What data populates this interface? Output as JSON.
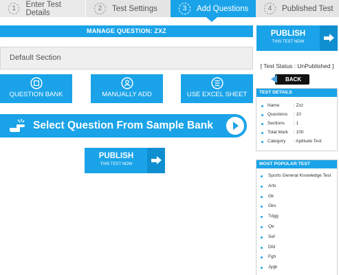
{
  "steps": [
    {
      "num": "1",
      "label": "Enter Test Details"
    },
    {
      "num": "2",
      "label": "Test Settings"
    },
    {
      "num": "3",
      "label": "Add Questions"
    },
    {
      "num": "4",
      "label": "Published Test"
    }
  ],
  "manage": {
    "title": "MANAGE QUESTION: ZXZ"
  },
  "section": {
    "name": "Default Section"
  },
  "actions": {
    "question_bank": "QUESTION BANK",
    "manually_add": "MANUALLY ADD",
    "excel": "USE EXCEL SHEET"
  },
  "sample_bank": {
    "label": "Select Question From Sample Bank"
  },
  "publish": {
    "title": "PUBLISH",
    "subtitle": "THIS TEST NOW"
  },
  "sidebar": {
    "status": "[ Test Status : UnPublished ]",
    "back": "BACK",
    "details_title": "TEST DETAILS",
    "details": [
      {
        "key": "Name",
        "value": ": Zxz"
      },
      {
        "key": "Questions",
        "value": ": 10"
      },
      {
        "key": "Sections",
        "value": ": 1"
      },
      {
        "key": "Total Mark",
        "value": ": 100"
      },
      {
        "key": "Category",
        "value": ": Aptitude Test"
      }
    ],
    "popular_title": "MOST POPULAR TEST",
    "popular": [
      "Sports General Knowledge Test",
      "Arts",
      "Gk",
      "Gks",
      "Tdgg",
      "Qe",
      "Sef",
      "Dfd",
      "Fgh",
      "Jygk"
    ]
  },
  "colors": {
    "accent": "#1aa3e8",
    "accent_dark": "#0f8fd0"
  }
}
